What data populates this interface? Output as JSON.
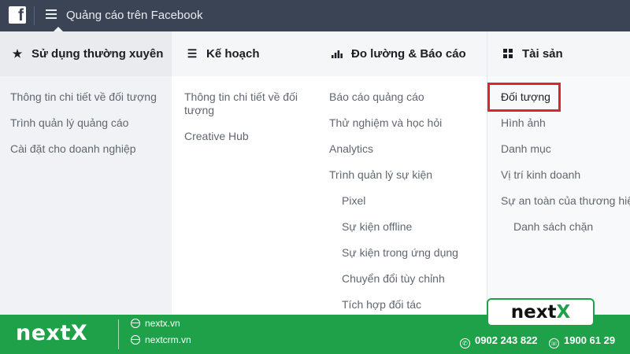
{
  "topbar": {
    "logo": "f",
    "title": "Quảng cáo trên Facebook"
  },
  "columns": [
    {
      "heading": "Sử dụng thường xuyên",
      "icon": "star-icon",
      "items": [
        "Thông tin chi tiết về đối tượng",
        "Trình quản lý quảng cáo",
        "Cài đặt cho doanh nghiệp"
      ]
    },
    {
      "heading": "Kế hoạch",
      "icon": "list-icon",
      "items": [
        "Thông tin chi tiết về đối tượng",
        "Creative Hub"
      ]
    },
    {
      "heading": "Đo lường & Báo cáo",
      "icon": "bar-chart-icon",
      "items": [
        "Báo cáo quảng cáo",
        "Thử nghiệm và học hỏi",
        "Analytics",
        "Trình quản lý sự kiện",
        "Pixel",
        "Sự kiện offline",
        "Sự kiện trong ứng dụng",
        "Chuyển đổi tùy chỉnh",
        "Tích hợp đối tác"
      ]
    },
    {
      "heading": "Tài sản",
      "icon": "grid-icon",
      "items": [
        "Đối tượng",
        "Hình ảnh",
        "Danh mục",
        "Vị trí kinh doanh",
        "Sự an toàn của thương hiệu",
        "Danh sách chặn"
      ]
    }
  ],
  "banner": {
    "brand": "nextX",
    "links": [
      "nextx.vn",
      "nextcrm.vn"
    ],
    "phone": "0902 243 822",
    "hotline": "1900 61 29",
    "badge_text": "next",
    "badge_accent": "X"
  },
  "colors": {
    "topbar": "#3a4455",
    "banner_green": "#1fa14a",
    "highlight_red": "#d8272d"
  }
}
